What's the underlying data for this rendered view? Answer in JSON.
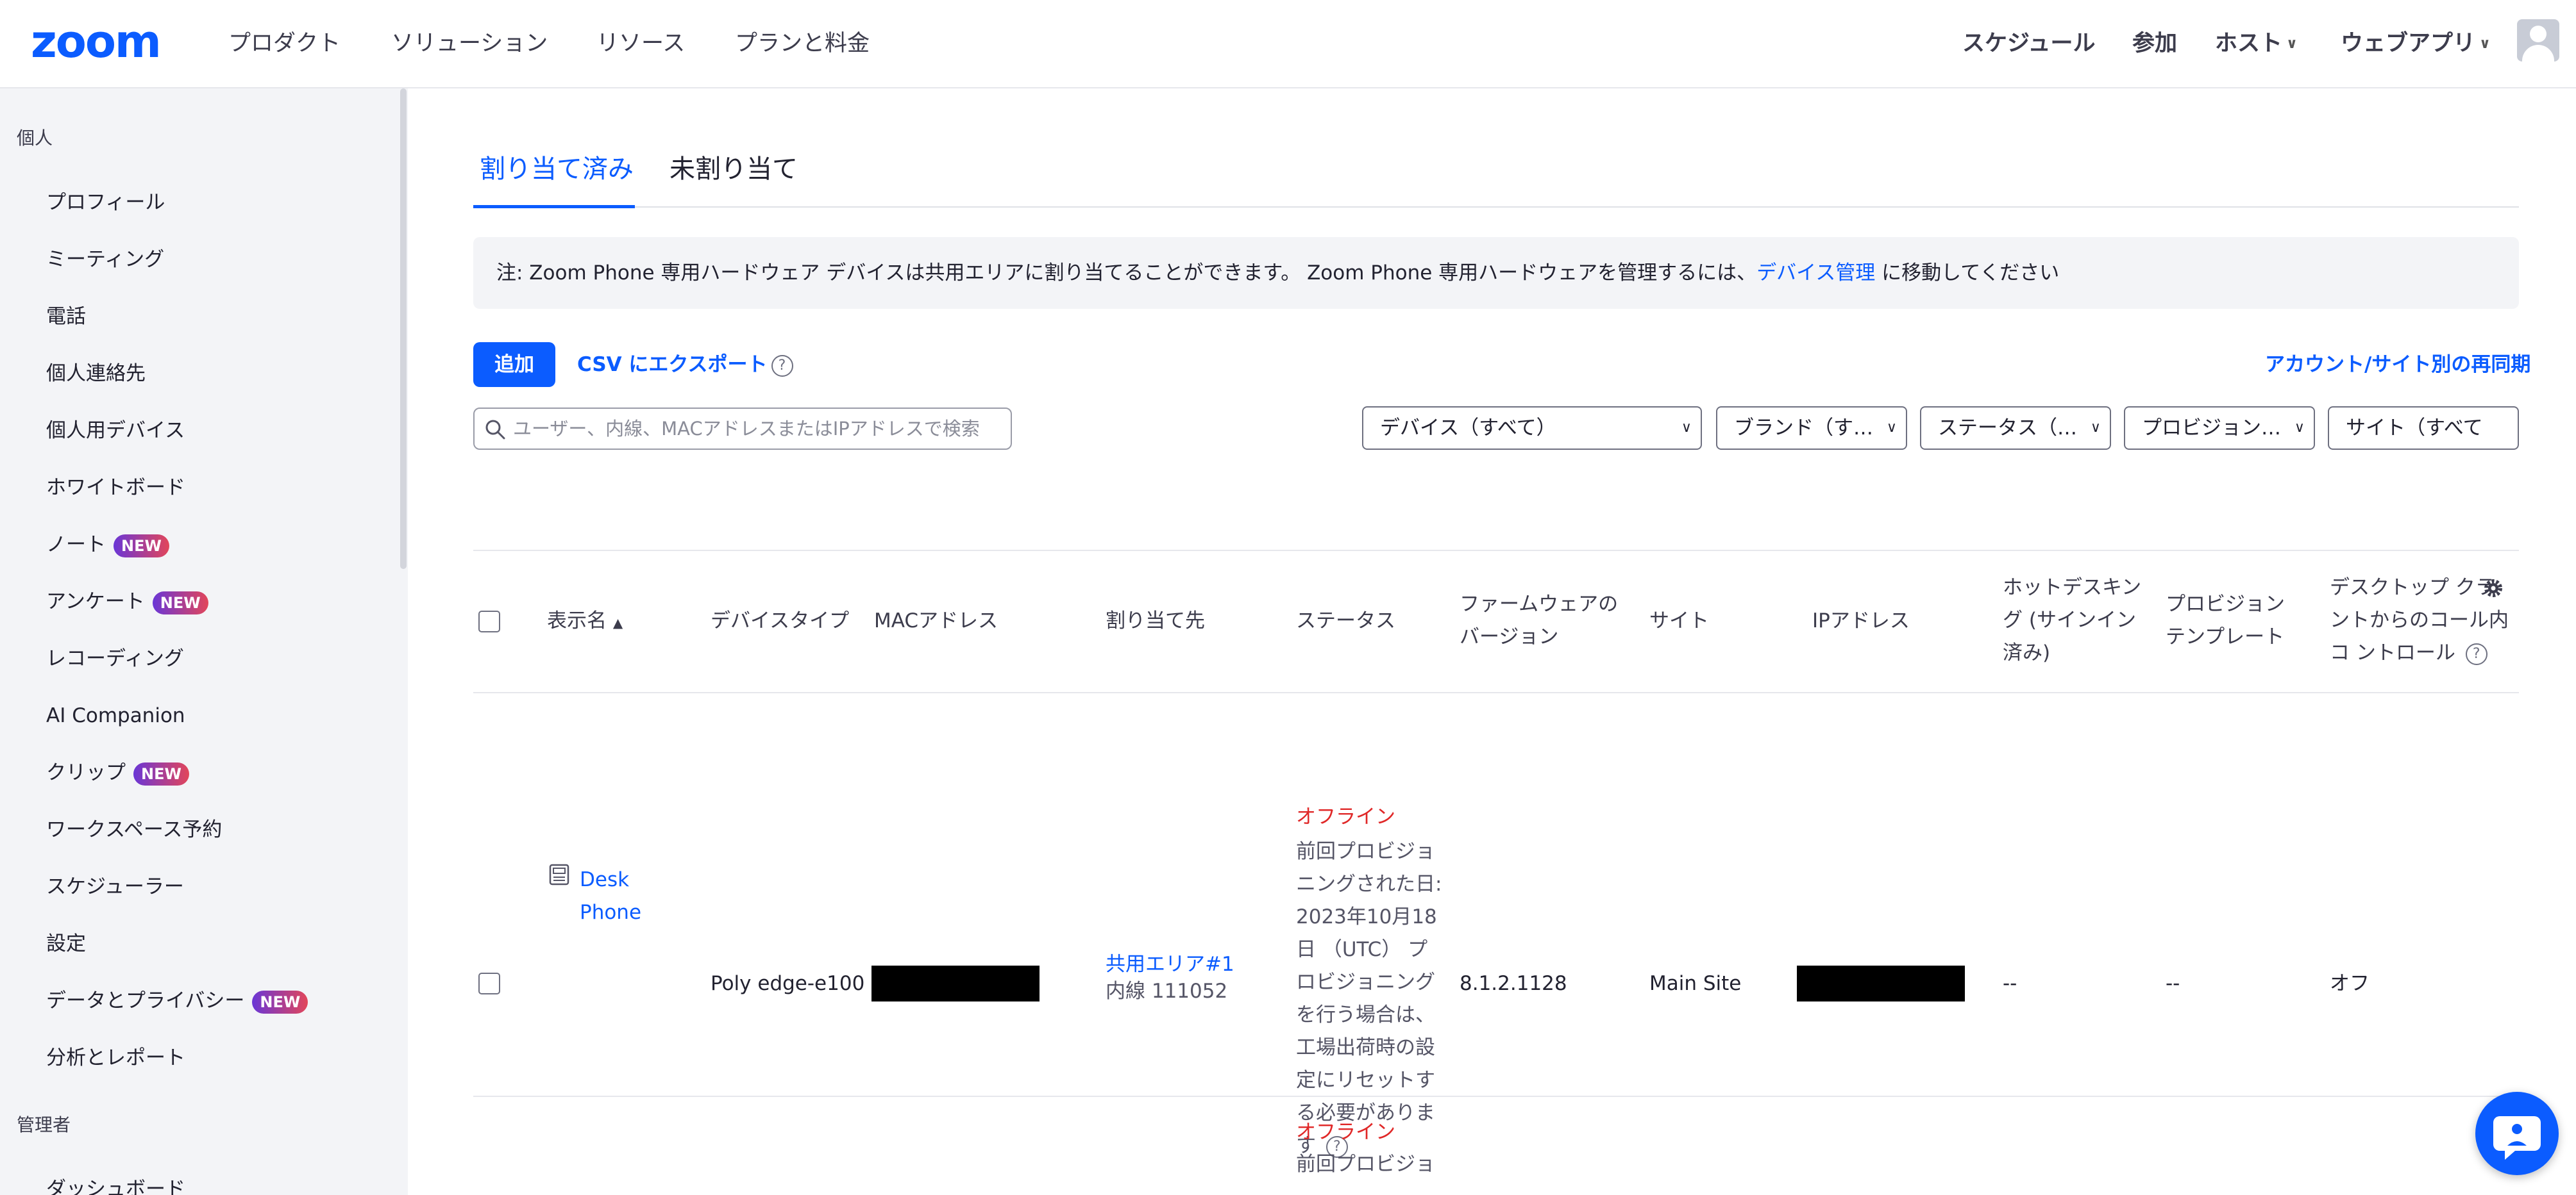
{
  "topnav": {
    "logo": "zoom",
    "left_items": [
      "プロダクト",
      "ソリューション",
      "リソース",
      "プランと料金"
    ],
    "right_items": {
      "schedule": "スケジュール",
      "join": "参加",
      "host": "ホスト",
      "webapp": "ウェブアプリ"
    }
  },
  "sidebar": {
    "section_personal": "個人",
    "items": [
      {
        "label": "プロフィール"
      },
      {
        "label": "ミーティング"
      },
      {
        "label": "電話"
      },
      {
        "label": "個人連絡先"
      },
      {
        "label": "個人用デバイス"
      },
      {
        "label": "ホワイトボード"
      },
      {
        "label": "ノート",
        "badge": "NEW"
      },
      {
        "label": "アンケート",
        "badge": "NEW"
      },
      {
        "label": "レコーディング"
      },
      {
        "label": "AI Companion"
      },
      {
        "label": "クリップ",
        "badge": "NEW"
      },
      {
        "label": "ワークスペース予約"
      },
      {
        "label": "スケジューラー"
      },
      {
        "label": "設定"
      },
      {
        "label": "データとプライバシー",
        "badge": "NEW"
      },
      {
        "label": "分析とレポート"
      }
    ],
    "section_admin": "管理者",
    "admin_partial_item": "ダッシュボード"
  },
  "tabs": {
    "assigned": "割り当て済み",
    "unassigned": "未割り当て"
  },
  "notice": {
    "text_before": "注: Zoom Phone 専用ハードウェア デバイスは共用エリアに割り当てることができます。 Zoom Phone 専用ハードウェアを管理するには、",
    "link": "デバイス管理",
    "text_after": " に移動してください"
  },
  "toolbar": {
    "add": "追加",
    "csv_export": "CSV にエクスポート",
    "help": "?",
    "resync": "アカウント/サイト別の再同期"
  },
  "search": {
    "placeholder": "ユーザー、内線、MACアドレスまたはIPアドレスで検索"
  },
  "filters": {
    "device": "デバイス（すべて）",
    "brand": "ブランド（す…",
    "status": "ステータス（…",
    "provisioning": "プロビジョン…",
    "site": "サイト（すべて"
  },
  "table": {
    "headers": {
      "display_name": "表示名",
      "device_type": "デバイスタイプ",
      "mac": "MACアドレス",
      "assigned_to": "割り当て先",
      "status": "ステータス",
      "firmware": "ファームウェアのバージョン",
      "site": "サイト",
      "ip": "IPアドレス",
      "hot_desking": "ホットデスキング (サインイン済み)",
      "prov_template": "プロビジョン テンプレート",
      "desktop_control": "デスクトップ クラ ントからのコール内コ ントロール"
    },
    "rows": [
      {
        "display_name": "Desk Phone",
        "device_type": "Poly edge-e100",
        "assigned_to": "共用エリア#1",
        "extension": "内線 111052",
        "status": "オフライン",
        "status_detail": "前回プロビジョニングされた日: 2023年10月18日 （UTC） プロビジョニングを行う場合は、工場出荷時の設定にリセットする必要があります",
        "firmware": "8.1.2.1128",
        "site": "Main Site",
        "hot_desking": "--",
        "prov_template": "--",
        "desktop_control": "オフ"
      },
      {
        "status": "オフライン",
        "status_detail": "前回プロビジョ"
      }
    ]
  },
  "colors": {
    "brand_blue": "#0b5cff",
    "offline_red": "#e02828",
    "sidebar_bg": "#f3f4f7"
  }
}
